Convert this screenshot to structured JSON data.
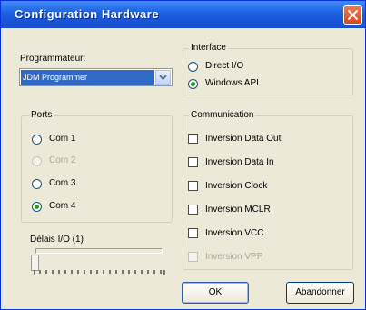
{
  "window": {
    "title": "Configuration Hardware"
  },
  "programmer": {
    "label": "Programmateur:",
    "selected": "JDM Programmer"
  },
  "ports": {
    "title": "Ports",
    "options": [
      {
        "label": "Com 1",
        "checked": false,
        "enabled": true
      },
      {
        "label": "Com 2",
        "checked": false,
        "enabled": false
      },
      {
        "label": "Com 3",
        "checked": false,
        "enabled": true
      },
      {
        "label": "Com 4",
        "checked": true,
        "enabled": true
      }
    ]
  },
  "delay": {
    "label": "Délais I/O (1)",
    "value": 1
  },
  "interface": {
    "title": "Interface",
    "options": [
      {
        "label": "Direct I/O",
        "checked": false
      },
      {
        "label": "Windows API",
        "checked": true
      }
    ]
  },
  "communication": {
    "title": "Communication",
    "options": [
      {
        "label": "Inversion Data Out",
        "checked": false,
        "enabled": true
      },
      {
        "label": "Inversion Data In",
        "checked": false,
        "enabled": true
      },
      {
        "label": "Inversion Clock",
        "checked": false,
        "enabled": true
      },
      {
        "label": "Inversion MCLR",
        "checked": false,
        "enabled": true
      },
      {
        "label": "Inversion VCC",
        "checked": false,
        "enabled": true
      },
      {
        "label": "Inversion VPP",
        "checked": false,
        "enabled": false
      }
    ]
  },
  "buttons": {
    "ok": "OK",
    "cancel": "Abandonner"
  },
  "colors": {
    "title_bar": "#1c5fe0",
    "close_button": "#d8461f",
    "face": "#ece9d8",
    "selection": "#316ac5",
    "radio_dot": "#21a121"
  },
  "icons": {
    "close": "close-icon",
    "dropdown": "chevron-down-icon"
  }
}
